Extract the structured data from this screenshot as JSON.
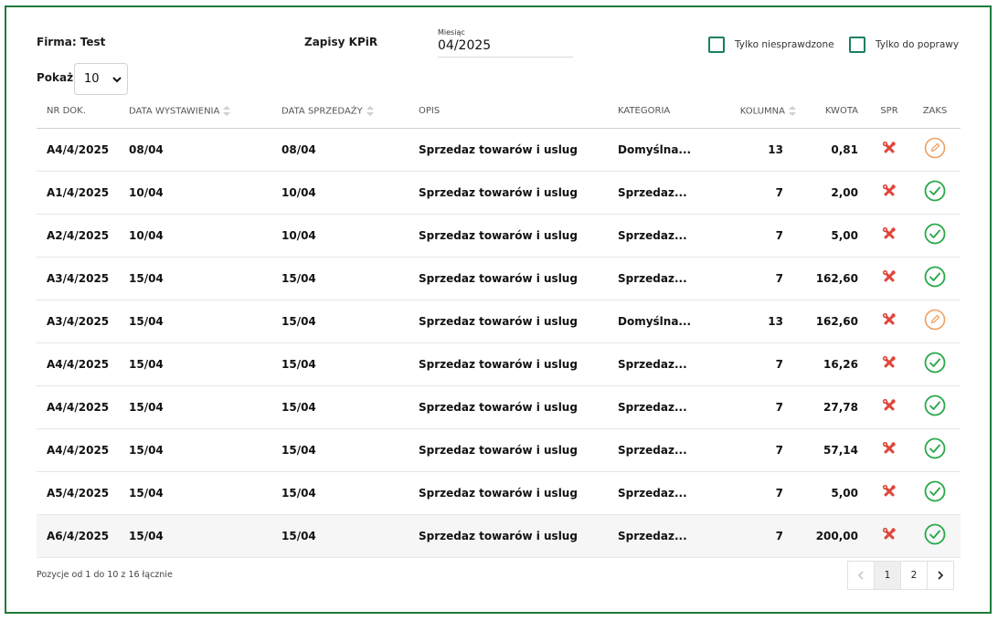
{
  "header": {
    "firma": "Firma: Test",
    "title": "Zapisy KPiR",
    "month_label": "Miesiąc",
    "month_value": "04/2025",
    "filter_unchecked_label": "Tylko niesprawdzone",
    "filter_fix_label": "Tylko do poprawy",
    "show_label": "Pokaż",
    "show_value": "10"
  },
  "columns": {
    "nr": "NR DOK.",
    "data_wyst": "DATA WYSTAWIENIA",
    "data_sprz": "DATA SPRZEDAŻY",
    "opis": "OPIS",
    "kategoria": "KATEGORIA",
    "kolumna": "KOLUMNA",
    "kwota": "KWOTA",
    "spr": "SPR",
    "zaks": "ZAKS"
  },
  "rows": [
    {
      "nr": "A4/4/2025",
      "data_wyst": "08/04",
      "data_sprz": "08/04",
      "opis": "Sprzedaz towarów i uslug",
      "kategoria": "Domyślna...",
      "kolumna": "13",
      "kwota": "0,81",
      "zaks": "edit"
    },
    {
      "nr": "A1/4/2025",
      "data_wyst": "10/04",
      "data_sprz": "10/04",
      "opis": "Sprzedaz towarów i uslug",
      "kategoria": "Sprzedaz...",
      "kolumna": "7",
      "kwota": "2,00",
      "zaks": "ok"
    },
    {
      "nr": "A2/4/2025",
      "data_wyst": "10/04",
      "data_sprz": "10/04",
      "opis": "Sprzedaz towarów i uslug",
      "kategoria": "Sprzedaz...",
      "kolumna": "7",
      "kwota": "5,00",
      "zaks": "ok"
    },
    {
      "nr": "A3/4/2025",
      "data_wyst": "15/04",
      "data_sprz": "15/04",
      "opis": "Sprzedaz towarów i uslug",
      "kategoria": "Sprzedaz...",
      "kolumna": "7",
      "kwota": "162,60",
      "zaks": "ok"
    },
    {
      "nr": "A3/4/2025",
      "data_wyst": "15/04",
      "data_sprz": "15/04",
      "opis": "Sprzedaz towarów i uslug",
      "kategoria": "Domyślna...",
      "kolumna": "13",
      "kwota": "162,60",
      "zaks": "edit"
    },
    {
      "nr": "A4/4/2025",
      "data_wyst": "15/04",
      "data_sprz": "15/04",
      "opis": "Sprzedaz towarów i uslug",
      "kategoria": "Sprzedaz...",
      "kolumna": "7",
      "kwota": "16,26",
      "zaks": "ok"
    },
    {
      "nr": "A4/4/2025",
      "data_wyst": "15/04",
      "data_sprz": "15/04",
      "opis": "Sprzedaz towarów i uslug",
      "kategoria": "Sprzedaz...",
      "kolumna": "7",
      "kwota": "27,78",
      "zaks": "ok"
    },
    {
      "nr": "A4/4/2025",
      "data_wyst": "15/04",
      "data_sprz": "15/04",
      "opis": "Sprzedaz towarów i uslug",
      "kategoria": "Sprzedaz...",
      "kolumna": "7",
      "kwota": "57,14",
      "zaks": "ok"
    },
    {
      "nr": "A5/4/2025",
      "data_wyst": "15/04",
      "data_sprz": "15/04",
      "opis": "Sprzedaz towarów i uslug",
      "kategoria": "Sprzedaz...",
      "kolumna": "7",
      "kwota": "5,00",
      "zaks": "ok"
    },
    {
      "nr": "A6/4/2025",
      "data_wyst": "15/04",
      "data_sprz": "15/04",
      "opis": "Sprzedaz towarów i uslug",
      "kategoria": "Sprzedaz...",
      "kolumna": "7",
      "kwota": "200,00",
      "zaks": "ok"
    }
  ],
  "footer": {
    "info": "Pozycje od 1 do 10 z 16 łącznie",
    "pages": [
      "1",
      "2"
    ],
    "active_page": "1"
  },
  "icons": {
    "spr": "tools-icon",
    "zaks_ok": "check-circle-icon",
    "zaks_edit": "pencil-circle-icon"
  },
  "colors": {
    "frame": "#1f7a3a",
    "checkbox": "#1a7f64",
    "tools": "#e0453a",
    "ok": "#2aa84a",
    "edit": "#f0a060"
  }
}
